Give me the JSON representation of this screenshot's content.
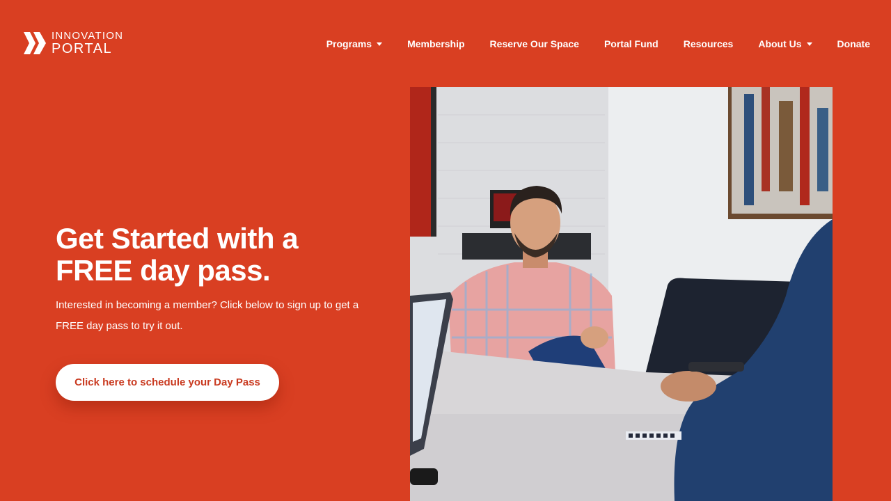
{
  "logo": {
    "line1": "INNOVATION",
    "line2": "PORTAL",
    "icon": "double-chevron-logo-icon"
  },
  "nav": {
    "items": [
      {
        "label": "Programs",
        "has_dropdown": true
      },
      {
        "label": "Membership",
        "has_dropdown": false
      },
      {
        "label": "Reserve Our Space",
        "has_dropdown": false
      },
      {
        "label": "Portal Fund",
        "has_dropdown": false
      },
      {
        "label": "Resources",
        "has_dropdown": false
      },
      {
        "label": "About Us",
        "has_dropdown": true
      },
      {
        "label": "Donate",
        "has_dropdown": false
      }
    ]
  },
  "hero": {
    "title_line1": "Get Started with a",
    "title_line2": "FREE day pass.",
    "subtitle": "Interested in becoming a member? Click below to sign up to get a FREE day pass to try it out.",
    "cta_label": "Click here to schedule your Day Pass"
  },
  "colors": {
    "background": "#d93f22",
    "cta_text": "#c93a20",
    "text": "#ffffff"
  }
}
